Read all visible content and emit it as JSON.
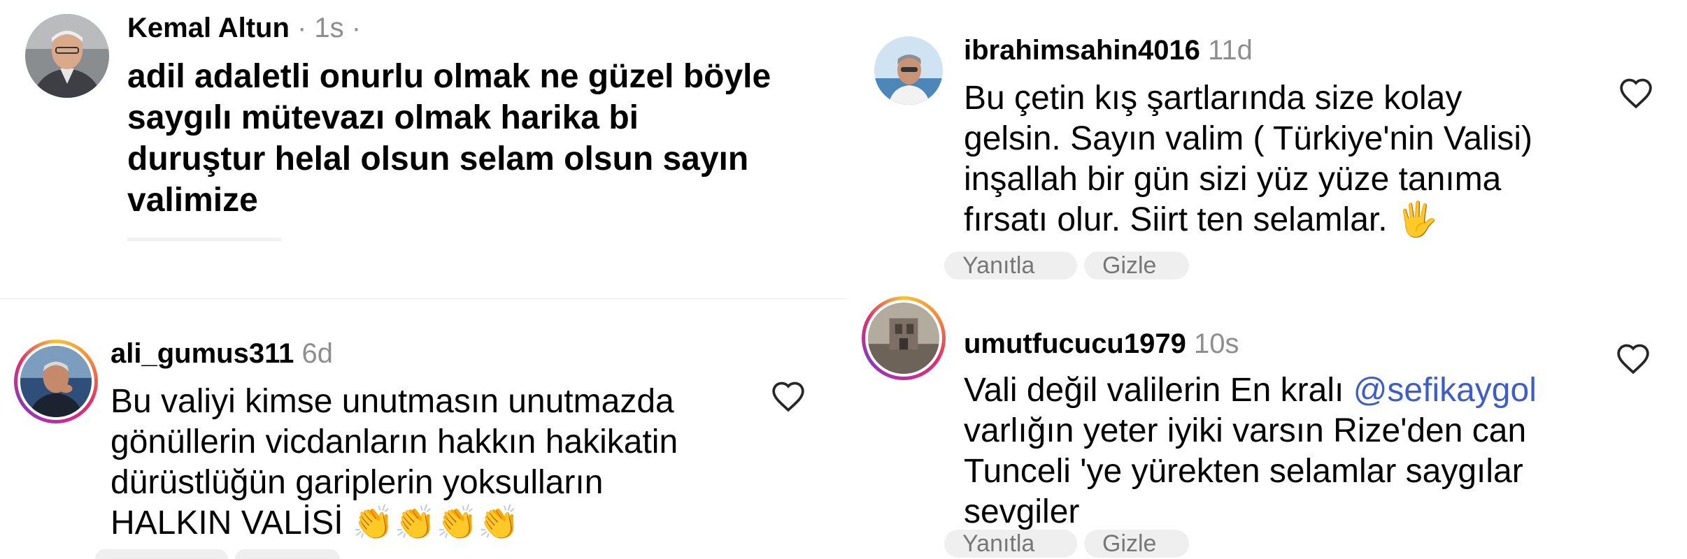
{
  "comments": [
    {
      "username": "Kemal Altun",
      "meta": " · 1s ·",
      "text": "adil adaletli onurlu olmak ne güzel böyle\nsaygılı mütevazı olmak harika bi\nduruştur helal olsun selam olsun sayın\nvalimize",
      "avatar_icon": "user-photo-icon"
    },
    {
      "username": "ibrahimsahin4016",
      "time": "11d",
      "text": "Bu çetin kış şartlarında size kolay\ngelsin. Sayın valim ( Türkiye'nin Valisi)\ninşallah bir gün sizi yüz yüze tanıma\nfırsatı olur. Siirt ten selamlar. ",
      "emoji": "🖐",
      "reply_label": "Yanıtla",
      "hide_label": "Gizle"
    },
    {
      "username": "ali_gumus311",
      "time": "6d",
      "text": "Bu valiyi kimse unutmasın unutmazda\ngönüllerin vicdanların hakkın hakikatin\ndürüstlüğün gariplerin yoksulların\nHALKIN VALİSİ ",
      "emoji": "👏👏👏👏"
    },
    {
      "username": "umutfucucu1979",
      "time": "10s",
      "text_before": "Vali değil valilerin En kralı ",
      "mention": "@sefikaygol",
      "text_after": "\nvarlığın yeter iyiki varsın Rize'den can\nTunceli 'ye yürekten selamlar saygılar\nsevgiler",
      "reply_label": "Yanıtla",
      "hide_label": "Gizle"
    }
  ],
  "colors": {
    "mention": "#3d5dc9",
    "muted": "#8e8e8e",
    "pill": "#efefef"
  }
}
